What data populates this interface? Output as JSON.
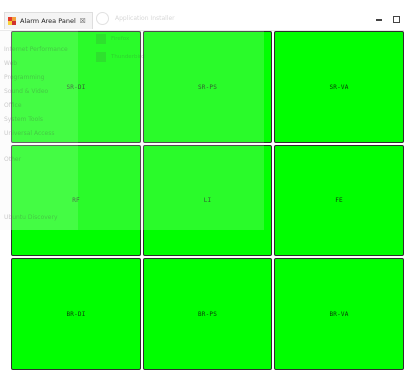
{
  "tab": {
    "title": "Alarm Area Panel",
    "close_glyph": "☒",
    "icon": "alarm-area-panel-icon"
  },
  "window_controls": {
    "minimize_icon": "minimize-icon",
    "maximize_icon": "maximize-icon"
  },
  "background_app": {
    "header_title": "Application Installer",
    "sidebar_items": [
      "Internet Performance",
      "Web",
      "Programming",
      "Sound & Video",
      "Office",
      "System Tools",
      "Universal Access",
      "Other",
      "Ubuntu Discovery"
    ],
    "content_items": [
      "Firefox",
      "Thunderbird"
    ]
  },
  "alarm_cells": [
    {
      "label": "SR-DI",
      "status_color": "#00ff00"
    },
    {
      "label": "SR-PS",
      "status_color": "#00ff00"
    },
    {
      "label": "SR-VA",
      "status_color": "#00ff00"
    },
    {
      "label": "RF",
      "status_color": "#00ff00"
    },
    {
      "label": "LI",
      "status_color": "#00ff00"
    },
    {
      "label": "FE",
      "status_color": "#00ff00"
    },
    {
      "label": "BR-DI",
      "status_color": "#00ff00"
    },
    {
      "label": "BR-PS",
      "status_color": "#00ff00"
    },
    {
      "label": "BR-VA",
      "status_color": "#00ff00"
    }
  ]
}
